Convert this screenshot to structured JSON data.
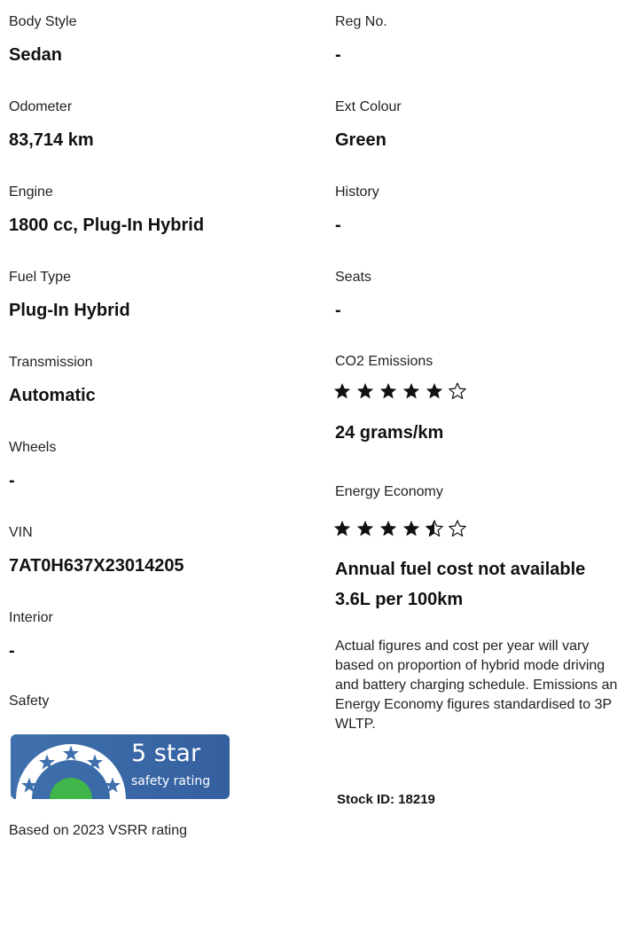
{
  "left_specs": [
    {
      "label": "Body Style",
      "value": "Sedan"
    },
    {
      "label": "Odometer",
      "value": "83,714 km"
    },
    {
      "label": "Engine",
      "value": "1800 cc, Plug-In Hybrid"
    },
    {
      "label": "Fuel Type",
      "value": "Plug-In Hybrid"
    },
    {
      "label": "Transmission",
      "value": "Automatic"
    },
    {
      "label": "Wheels",
      "value": "-"
    },
    {
      "label": "VIN",
      "value": "7AT0H637X23014205"
    },
    {
      "label": "Interior",
      "value": "-"
    }
  ],
  "right_specs": [
    {
      "label": "Reg No.",
      "value": "-"
    },
    {
      "label": "Ext Colour",
      "value": "Green"
    },
    {
      "label": "History",
      "value": "-"
    },
    {
      "label": "Seats",
      "value": "-"
    }
  ],
  "safety": {
    "label": "Safety",
    "badge_main": "5 star",
    "badge_sub": "safety rating",
    "note": "Based on 2023 VSRR rating",
    "stars": 5
  },
  "co2": {
    "label": "CO2 Emissions",
    "rating": 5,
    "max": 6,
    "value": "24 grams/km"
  },
  "energy": {
    "label": "Energy Economy",
    "rating": 4.5,
    "max": 6,
    "annual_cost": "Annual fuel cost not available",
    "consumption": "3.6L per 100km",
    "disclaimer": "Actual figures and cost per year will vary based on proportion of hybrid mode driving and battery charging schedule. Emissions and Energy Economy figures standardised to 3P WLTP."
  },
  "stock": {
    "text": "Stock ID: 18219"
  },
  "colors": {
    "badge_blue": "#3f70ad",
    "badge_green": "#3fb54a",
    "star_dark": "#111111"
  }
}
